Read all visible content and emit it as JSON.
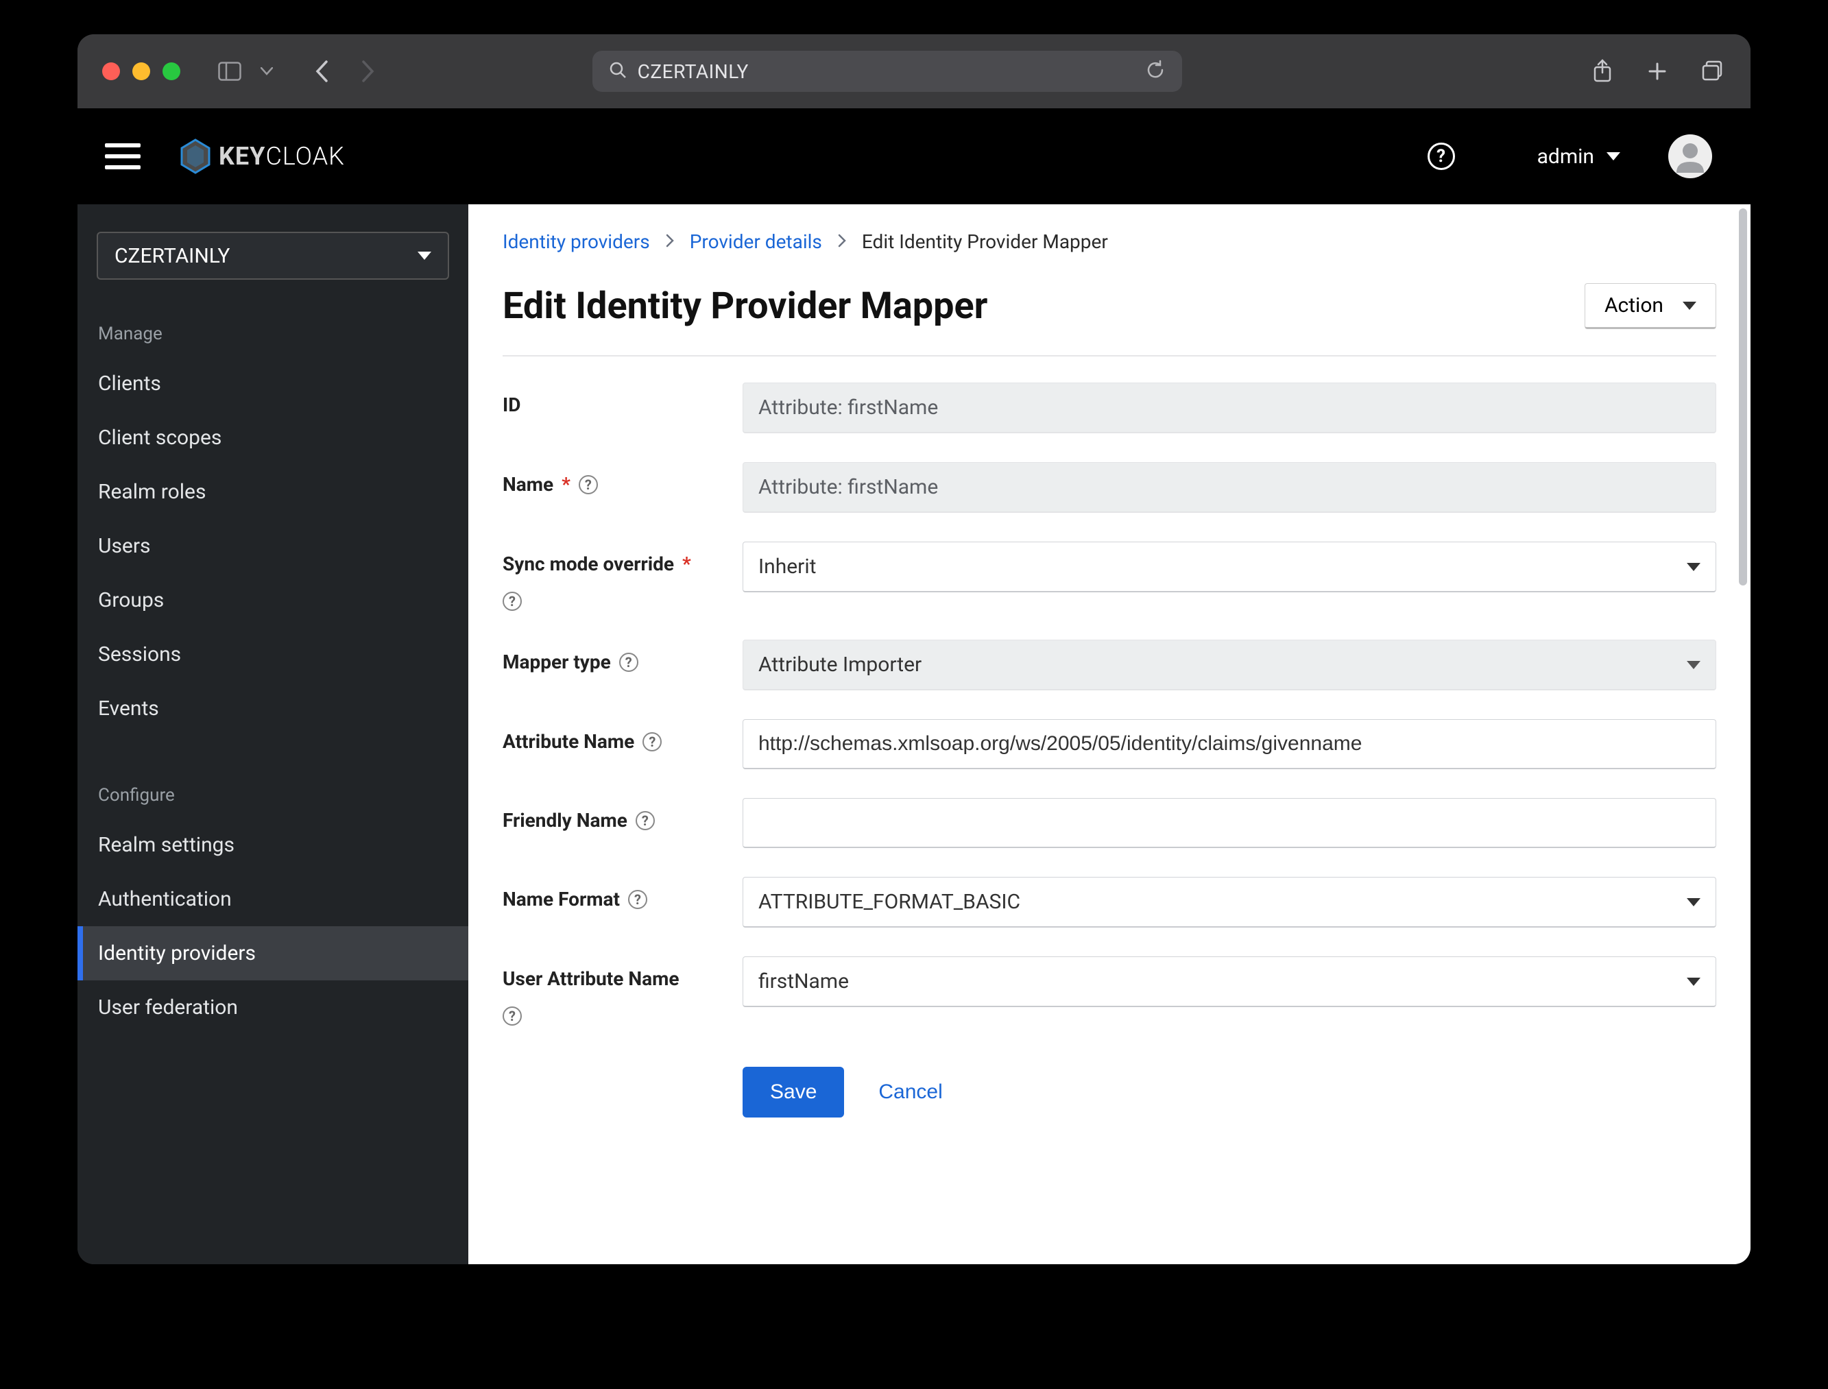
{
  "browser": {
    "url_text": "CZERTAINLY"
  },
  "app_header": {
    "logo_text_bold": "KEY",
    "logo_text_light": "CLOAK",
    "user_name": "admin"
  },
  "sidebar": {
    "realm": "CZERTAINLY",
    "manage_label": "Manage",
    "configure_label": "Configure",
    "manage_items": [
      "Clients",
      "Client scopes",
      "Realm roles",
      "Users",
      "Groups",
      "Sessions",
      "Events"
    ],
    "configure_items": [
      "Realm settings",
      "Authentication",
      "Identity providers",
      "User federation"
    ],
    "active_item": "Identity providers"
  },
  "breadcrumbs": {
    "items": [
      {
        "label": "Identity providers",
        "link": true
      },
      {
        "label": "Provider details",
        "link": true
      },
      {
        "label": "Edit Identity Provider Mapper",
        "link": false
      }
    ]
  },
  "page": {
    "title": "Edit Identity Provider Mapper",
    "action_label": "Action"
  },
  "form": {
    "id_label": "ID",
    "id_value": "Attribute: firstName",
    "name_label": "Name",
    "name_value": "Attribute: firstName",
    "sync_label": "Sync mode override",
    "sync_value": "Inherit",
    "mapper_type_label": "Mapper type",
    "mapper_type_value": "Attribute Importer",
    "attr_name_label": "Attribute Name",
    "attr_name_value": "http://schemas.xmlsoap.org/ws/2005/05/identity/claims/givenname",
    "friendly_label": "Friendly Name",
    "friendly_value": "",
    "name_format_label": "Name Format",
    "name_format_value": "ATTRIBUTE_FORMAT_BASIC",
    "user_attr_label": "User Attribute Name",
    "user_attr_value": "firstName",
    "save_label": "Save",
    "cancel_label": "Cancel"
  }
}
